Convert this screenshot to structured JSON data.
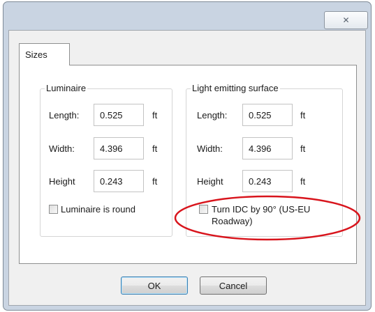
{
  "dialog": {
    "close_glyph": "✕"
  },
  "tabs": [
    {
      "label": "Sizes",
      "selected": true
    }
  ],
  "luminaire": {
    "title": "Luminaire",
    "length_label": "Length:",
    "length_value": "0.525",
    "width_label": "Width:",
    "width_value": "4.396",
    "height_label": "Height",
    "height_value": "0.243",
    "unit": "ft",
    "round_checkbox_label": "Luminaire is round",
    "round_checked": false
  },
  "light_emitting_surface": {
    "title": "Light emitting surface",
    "length_label": "Length:",
    "length_value": "0.525",
    "width_label": "Width:",
    "width_value": "4.396",
    "height_label": "Height",
    "height_value": "0.243",
    "unit": "ft",
    "turn_checkbox_label_line1": "Turn IDC by 90° (US-EU",
    "turn_checkbox_label_line2": "Roadway)",
    "turn_checked": false
  },
  "buttons": {
    "ok_label": "OK",
    "cancel_label": "Cancel"
  },
  "colors": {
    "highlight_ellipse": "#d8141c",
    "frame": "#c9d4e2"
  },
  "icons": {
    "close": "close-icon",
    "checkbox": "checkbox-icon"
  }
}
